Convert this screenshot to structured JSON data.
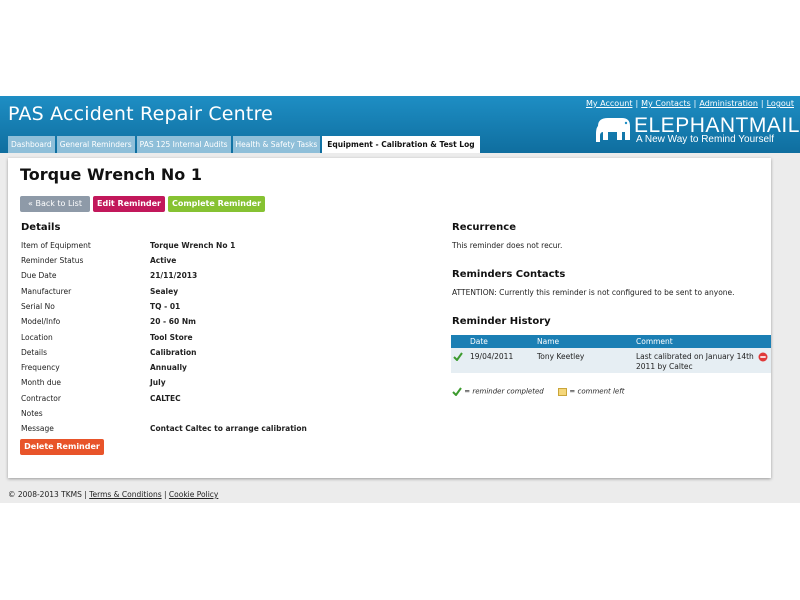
{
  "header": {
    "app_title": "PAS Accident Repair Centre",
    "links": [
      "My Account",
      "My Contacts",
      "Administration",
      "Logout"
    ],
    "logo_word": "ELEPHANTMAIL",
    "logo_tagline": "A New Way to Remind Yourself"
  },
  "tabs": [
    {
      "label": "Dashboard"
    },
    {
      "label": "General Reminders"
    },
    {
      "label": "PAS 125 Internal Audits"
    },
    {
      "label": "Health & Safety Tasks"
    },
    {
      "label": "Equipment - Calibration & Test Log",
      "active": true
    }
  ],
  "page_title": "Torque Wrench No 1",
  "buttons": {
    "back": "« Back to List",
    "edit": "Edit Reminder",
    "complete": "Complete Reminder",
    "delete": "Delete Reminder"
  },
  "details": {
    "heading": "Details",
    "rows": [
      {
        "label": "Item of Equipment",
        "value": "Torque Wrench No 1"
      },
      {
        "label": "Reminder Status",
        "value": "Active"
      },
      {
        "label": "Due Date",
        "value": "21/11/2013"
      },
      {
        "label": "Manufacturer",
        "value": "Sealey"
      },
      {
        "label": "Serial No",
        "value": "TQ - 01"
      },
      {
        "label": "Model/Info",
        "value": "20 - 60 Nm"
      },
      {
        "label": "Location",
        "value": "Tool Store"
      },
      {
        "label": "Details",
        "value": "Calibration"
      },
      {
        "label": "Frequency",
        "value": "Annually"
      },
      {
        "label": "Month due",
        "value": "July"
      },
      {
        "label": "Contractor",
        "value": "CALTEC"
      },
      {
        "label": "Notes",
        "value": ""
      },
      {
        "label": "Message",
        "value": "Contact Caltec to arrange calibration"
      }
    ]
  },
  "recurrence": {
    "heading": "Recurrence",
    "text": "This reminder does not recur."
  },
  "contacts": {
    "heading": "Reminders Contacts",
    "text": "ATTENTION: Currently this reminder is not configured to be sent to anyone."
  },
  "history": {
    "heading": "Reminder History",
    "columns": [
      "Date",
      "Name",
      "Comment"
    ],
    "rows": [
      {
        "date": "19/04/2011",
        "name": "Tony Keetley",
        "comment_line1": "Last calibrated on January 14th",
        "comment_line2": "2011 by Caltec"
      }
    ],
    "legend_completed": "= reminder completed",
    "legend_comment": "= comment left"
  },
  "footer": {
    "copyright": "© 2008-2013 TKMS",
    "terms": "Terms & Conditions",
    "cookie": "Cookie Policy"
  },
  "colors": {
    "header_blue": "#1b86bd",
    "tab_inactive": "#8fbfd9",
    "edit_button": "#c2185b",
    "complete_button": "#86c232",
    "delete_button": "#e8542a",
    "back_button": "#8e9aa8"
  }
}
